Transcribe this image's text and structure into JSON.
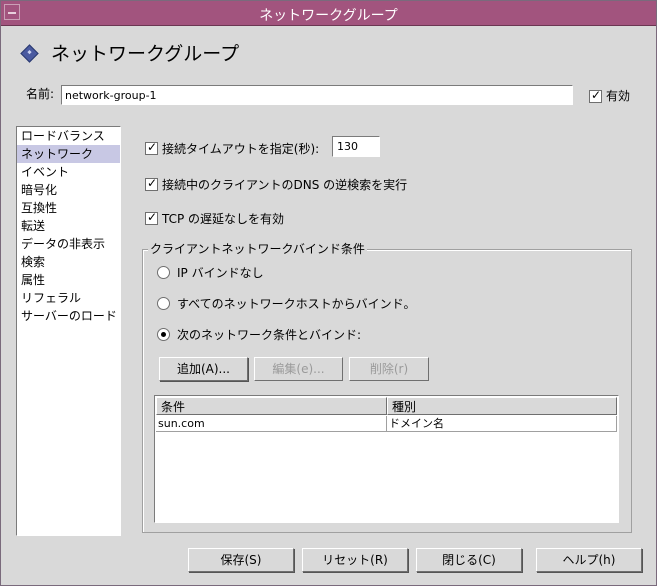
{
  "window": {
    "title": "ネットワークグループ"
  },
  "header": {
    "title": "ネットワークグループ"
  },
  "name_field": {
    "label": "名前:",
    "value": "network-group-1"
  },
  "enabled": {
    "label": "有効",
    "checked": true
  },
  "nav": {
    "items": [
      {
        "label": "ロードバランス"
      },
      {
        "label": "ネットワーク"
      },
      {
        "label": "イベント"
      },
      {
        "label": "暗号化"
      },
      {
        "label": "互換性"
      },
      {
        "label": "転送"
      },
      {
        "label": "データの非表示"
      },
      {
        "label": "検索"
      },
      {
        "label": "属性"
      },
      {
        "label": "リフェラル"
      },
      {
        "label": "サーバーのロード"
      }
    ],
    "selected": "ネットワーク"
  },
  "options": {
    "timeout": {
      "label": "接続タイムアウトを指定(秒):",
      "checked": true,
      "value": "130"
    },
    "dns": {
      "label": "接続中のクライアントのDNS の逆検索を実行",
      "checked": true
    },
    "tcp": {
      "label": "TCP の遅延なしを有効",
      "checked": true
    }
  },
  "bind_group": {
    "title": "クライアントネットワークバインド条件",
    "radios": [
      {
        "label": "IP バインドなし",
        "selected": false
      },
      {
        "label": "すべてのネットワークホストからバインド。",
        "selected": false
      },
      {
        "label": "次のネットワーク条件とバインド:",
        "selected": true
      }
    ],
    "buttons": {
      "add": "追加(A)...",
      "edit": "編集(e)...",
      "delete": "削除(r)"
    },
    "table": {
      "headers": [
        "条件",
        "種別"
      ],
      "rows": [
        [
          "sun.com",
          "ドメイン名"
        ]
      ]
    }
  },
  "footer": {
    "save": "保存(S)",
    "reset": "リセット(R)",
    "close": "閉じる(C)",
    "help": "ヘルプ(h)"
  },
  "colors": {
    "titlebar": "#a2547e",
    "background": "#d9d9d9",
    "selection": "#c8c8e4"
  }
}
